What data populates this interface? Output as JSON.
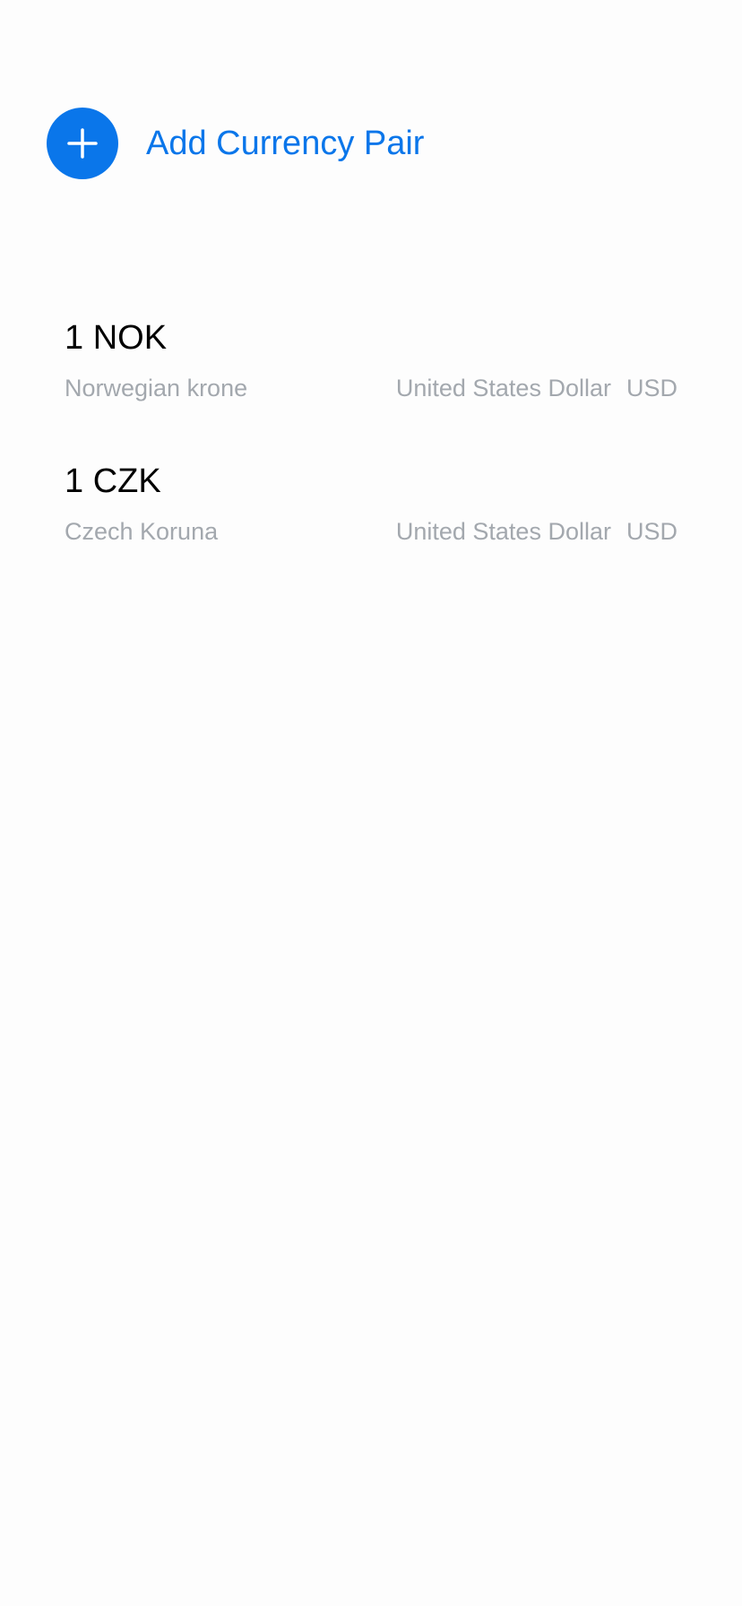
{
  "colors": {
    "accent": "#0a76ea",
    "secondary_text": "#a3a8ae",
    "primary_text": "#000000",
    "background": "#fdfdfd"
  },
  "add_pair": {
    "icon": "plus-icon",
    "label": "Add Currency Pair"
  },
  "pairs": [
    {
      "amount": "1 NOK",
      "from_name": "Norwegian krone",
      "to_name": "United States Dollar",
      "to_code": "USD"
    },
    {
      "amount": "1 CZK",
      "from_name": "Czech Koruna",
      "to_name": "United States Dollar",
      "to_code": "USD"
    }
  ]
}
